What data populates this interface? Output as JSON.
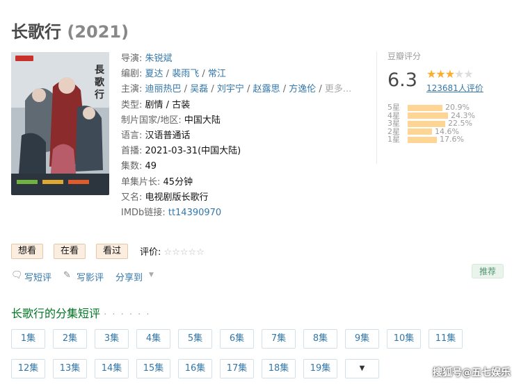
{
  "title": {
    "name": "长歌行",
    "year": "(2021)"
  },
  "poster": {
    "alt": "长歌行 poster"
  },
  "info": {
    "director_label": "导演",
    "director": "朱锐斌",
    "writers_label": "编剧",
    "writers": [
      "夏达",
      "裴雨飞",
      "常江"
    ],
    "cast_label": "主演",
    "cast": [
      "迪丽热巴",
      "吴磊",
      "刘宇宁",
      "赵露思",
      "方逸伦"
    ],
    "cast_more": "更多...",
    "genre_label": "类型",
    "genres": [
      "剧情",
      "古装"
    ],
    "country_label": "制片国家/地区",
    "country": "中国大陆",
    "language_label": "语言",
    "language": "汉语普通话",
    "premiere_label": "首播",
    "premiere": "2021-03-31(中国大陆)",
    "episodes_label": "集数",
    "episodes": "49",
    "runtime_label": "单集片长",
    "runtime": "45分钟",
    "aka_label": "又名",
    "aka": "电视剧版长歌行",
    "imdb_label": "IMDb链接",
    "imdb": "tt14390970"
  },
  "rating": {
    "label": "豆瓣评分",
    "score": "6.3",
    "stars_on": 3,
    "votes": "123681人评价",
    "distribution": [
      {
        "label": "5星",
        "percent": 20.9,
        "text": "20.9%"
      },
      {
        "label": "4星",
        "percent": 24.3,
        "text": "24.3%"
      },
      {
        "label": "3星",
        "percent": 22.5,
        "text": "22.5%"
      },
      {
        "label": "2星",
        "percent": 14.6,
        "text": "14.6%"
      },
      {
        "label": "1星",
        "percent": 17.6,
        "text": "17.6%"
      }
    ]
  },
  "buttons": {
    "want": "想看",
    "watching": "在看",
    "watched": "看过"
  },
  "myrate": {
    "label": "评价:",
    "stars": "☆☆☆☆☆"
  },
  "actions": {
    "short_review": "写短评",
    "review": "写影评",
    "share": "分享到",
    "share_arrow": "▼"
  },
  "recommend": "推荐",
  "episodes_section": {
    "title": "长歌行的分集短评",
    "dots": "· · · · · ·",
    "row1": [
      "1集",
      "2集",
      "3集",
      "4集",
      "5集",
      "6集",
      "7集",
      "8集",
      "9集",
      "10集",
      "11集"
    ],
    "row2": [
      "12集",
      "13集",
      "14集",
      "15集",
      "16集",
      "17集",
      "18集",
      "19集"
    ],
    "more": "▼"
  },
  "watermark": "搜狐号@五七娱乐",
  "colors": {
    "link": "#3377aa",
    "star": "#ffac2d",
    "bar": "#ffd596",
    "section": "#007722"
  }
}
